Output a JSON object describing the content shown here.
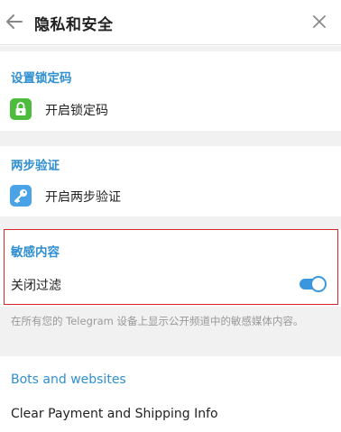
{
  "header": {
    "title": "隐私和安全"
  },
  "sections": {
    "passcode": {
      "title": "设置锁定码",
      "item_label": "开启锁定码"
    },
    "two_step": {
      "title": "两步验证",
      "item_label": "开启两步验证"
    },
    "sensitive": {
      "title": "敏感内容",
      "toggle_label": "关闭过滤",
      "toggle_on": true,
      "hint": "在所有您的 Telegram 设备上显示公开频道中的敏感媒体内容。"
    },
    "bots": {
      "title": "Bots and websites",
      "item_label": "Clear Payment and Shipping Info"
    }
  },
  "colors": {
    "accent": "#2f8fd0",
    "lock_icon_bg": "#4dbb3c",
    "key_icon_bg": "#4aa3e6",
    "highlight_border": "#d62a2a"
  },
  "icons": {
    "back": "arrow-left-icon",
    "close": "close-icon",
    "lock": "lock-icon",
    "key": "key-icon"
  }
}
